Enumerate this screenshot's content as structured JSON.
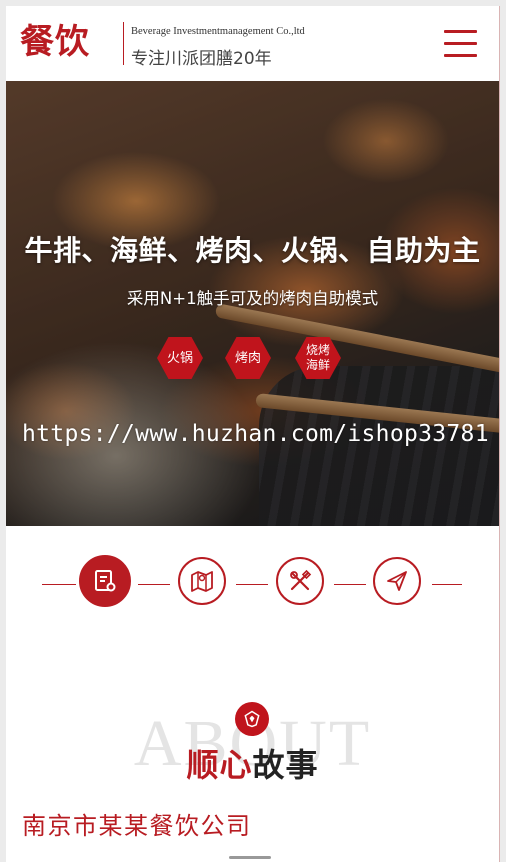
{
  "header": {
    "logo_cn": "餐饮",
    "logo_en": "Beverage Investmentmanagement Co.,ltd",
    "slogan": "专注川派团膳20年",
    "menu_icon": "hamburger-menu-icon"
  },
  "hero": {
    "title": "牛排、海鲜、烤肉、火锅、自助为主",
    "subtitle": "采用N+1触手可及的烤肉自助模式",
    "tags": [
      "火锅",
      "烤肉",
      "烧烤海鲜"
    ],
    "watermark": "https://www.huzhan.com/ishop33781"
  },
  "steps": [
    {
      "icon": "menu-list-icon",
      "active": true
    },
    {
      "icon": "map-icon",
      "active": false
    },
    {
      "icon": "utensils-icon",
      "active": false
    },
    {
      "icon": "paper-plane-icon",
      "active": false
    }
  ],
  "about": {
    "bg_text": "ABOUT",
    "title_accent": "顺心",
    "title_rest": "故事",
    "company": "南京市某某餐饮公司"
  },
  "colors": {
    "brand_red": "#b81c22",
    "tag_red": "#c0141c"
  }
}
